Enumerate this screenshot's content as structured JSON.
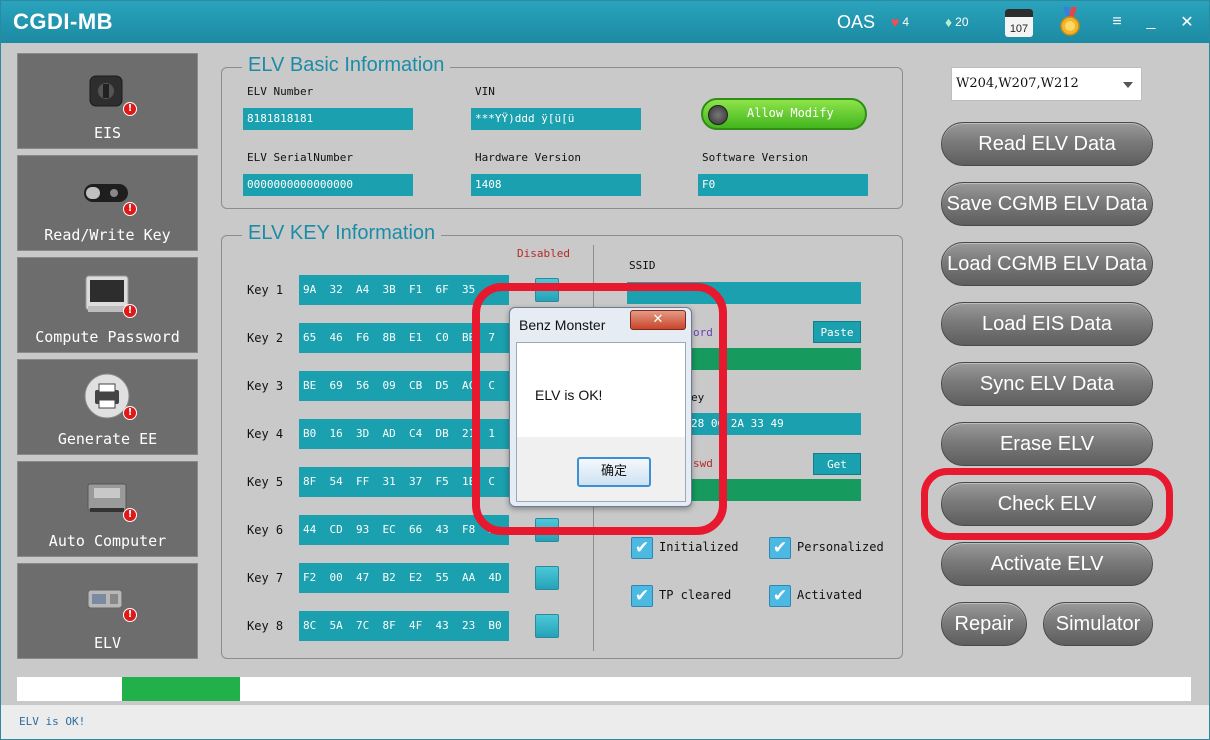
{
  "app": {
    "title": "CGDI-MB",
    "oas_label": "OAS",
    "hearts": "4",
    "gems": "20",
    "calendar_day": "107",
    "menu_glyph": "≡",
    "minimize_glyph": "_",
    "close_glyph": "✕"
  },
  "sidebar": {
    "items": [
      {
        "label": "EIS",
        "icon": "ignition-switch-icon"
      },
      {
        "label": "Read/Write Key",
        "icon": "car-key-icon"
      },
      {
        "label": "Compute Password",
        "icon": "computer-icon"
      },
      {
        "label": "Generate EE",
        "icon": "printer-icon"
      },
      {
        "label": "Auto Computer",
        "icon": "ecu-module-icon"
      },
      {
        "label": "ELV",
        "icon": "steering-lock-icon"
      }
    ],
    "badge_glyph": "!"
  },
  "elv_basic": {
    "title": "ELV Basic Information",
    "elv_number_label": "ELV Number",
    "elv_number_value": "8181818181",
    "vin_label": "VIN",
    "vin_value": "***YŸ)ddd ÿ[ü[ü",
    "allow_modify_label": "Allow Modify",
    "serial_label": "ELV SerialNumber",
    "serial_value": "0000000000000000",
    "hw_label": "Hardware Version",
    "hw_value": "1408",
    "sw_label": "Software Version",
    "sw_value": "F0"
  },
  "elv_key": {
    "title": "ELV KEY Information",
    "disabled_label": "Disabled",
    "keys": [
      {
        "label": "Key 1",
        "value": "9A  32  A4  3B  F1  6F  35  0"
      },
      {
        "label": "Key 2",
        "value": "65  46  F6  8B  E1  C0  BB  7"
      },
      {
        "label": "Key 3",
        "value": "BE  69  56  09  CB  D5  AC  C"
      },
      {
        "label": "Key 4",
        "value": "B0  16  3D  AD  C4  DB  21  1"
      },
      {
        "label": "Key 5",
        "value": "8F  54  FF  31  37  F5  1E  C"
      },
      {
        "label": "Key 6",
        "value": "44  CD  93  EC  66  43  F8  D"
      },
      {
        "label": "Key 7",
        "value": "F2  00  47  B2  E2  55  AA  4D"
      },
      {
        "label": "Key 8",
        "value": "8C  5A  7C  8F  4F  43  23  B0"
      }
    ],
    "ssid_label": "SSID",
    "ssid_value": "",
    "password_label_partial": "ord",
    "paste_label": "Paste",
    "password_value": "",
    "key_label_partial": "ey",
    "key_value_partial": "28  0C  2A  33  49",
    "password2_label_partial": "swd",
    "get_label": "Get",
    "password2_value": "",
    "checks": [
      {
        "label": "Initialized"
      },
      {
        "label": "Personalized"
      },
      {
        "label": "TP cleared"
      },
      {
        "label": "Activated"
      }
    ],
    "check_glyph": "✔"
  },
  "model_select": {
    "value": "W204,W207,W212"
  },
  "actions": {
    "read_elv": "Read  ELV Data",
    "save_cgmb": "Save CGMB ELV Data",
    "load_cgmb": "Load CGMB ELV Data",
    "load_eis": "Load EIS Data",
    "sync_elv": "Sync ELV Data",
    "erase_elv": "Erase ELV",
    "check_elv": "Check ELV",
    "activate_elv": "Activate ELV",
    "repair": "Repair",
    "simulator": "Simulator"
  },
  "dialog": {
    "title": "Benz Monster",
    "message": "ELV is OK!",
    "ok_label": "确定",
    "close_glyph": "✕"
  },
  "progress": {
    "fraction": 0.19
  },
  "status": {
    "text": "ELV is OK!"
  }
}
